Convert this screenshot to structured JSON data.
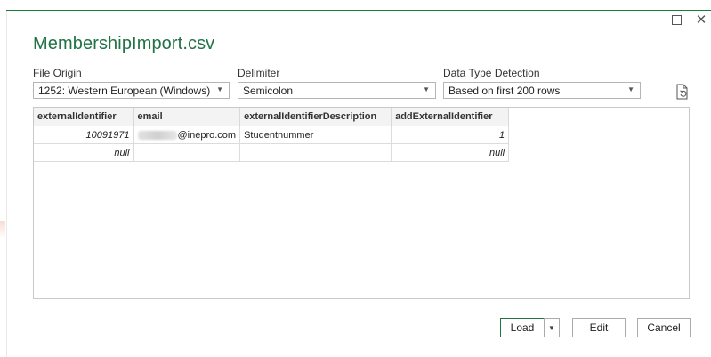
{
  "window": {
    "title": "MembershipImport.csv",
    "maximize_icon": "maximize-icon",
    "close_icon": "close-icon",
    "close_glyph": "✕"
  },
  "options": {
    "file_origin": {
      "label": "File Origin",
      "value": "1252: Western European (Windows)"
    },
    "delimiter": {
      "label": "Delimiter",
      "value": "Semicolon"
    },
    "type_detection": {
      "label": "Data Type Detection",
      "value": "Based on first 200 rows"
    },
    "refresh_icon": "refresh-document-icon"
  },
  "preview": {
    "columns": [
      "externalIdentifier",
      "email",
      "externalIdentifierDescription",
      "addExternalIdentifier"
    ],
    "rows": [
      [
        "10091971",
        "@inepro.com",
        "Studentnummer",
        "1"
      ],
      [
        "null",
        "",
        "",
        "null"
      ]
    ]
  },
  "buttons": {
    "load": "Load",
    "load_arrow": "▼",
    "edit": "Edit",
    "cancel": "Cancel"
  },
  "colors": {
    "accent": "#217346"
  }
}
